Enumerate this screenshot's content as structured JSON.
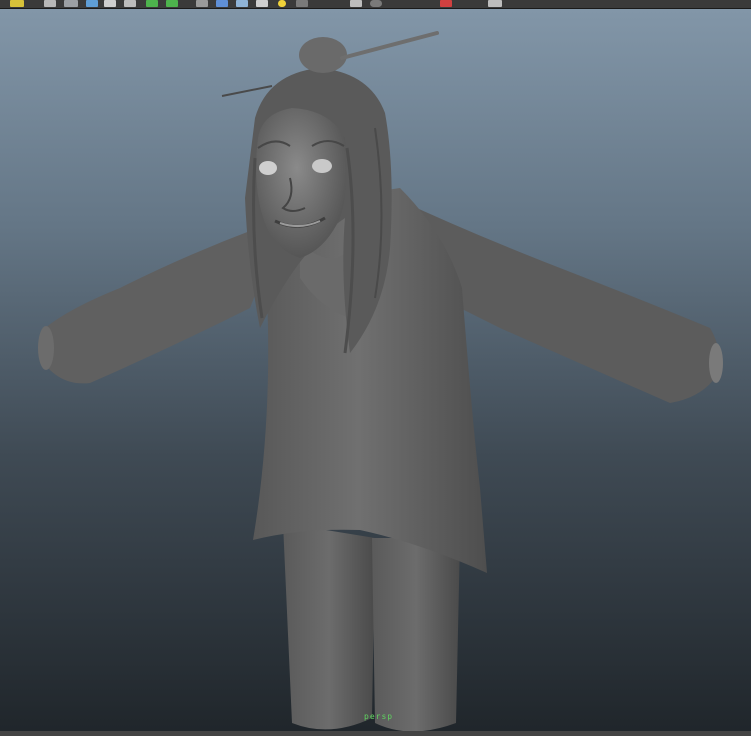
{
  "toolbar": {
    "icons": [
      "undo-icon",
      "render-icon",
      "grid-icon",
      "camera-icon",
      "film-gate-icon",
      "shaded-icon",
      "textured-icon",
      "lights-icon",
      "xray-icon",
      "isolate-icon",
      "wireframe-icon",
      "smooth-shade-icon",
      "default-light-icon",
      "shadow-icon",
      "ambient-occlusion-icon",
      "motion-blur-icon",
      "antialias-icon",
      "depth-icon"
    ]
  },
  "viewport": {
    "camera_label": "persp",
    "colors": {
      "gradient_top": "#8296a8",
      "gradient_bottom": "#20262b",
      "model": "#6a6a6a",
      "label": "#5fd35f"
    }
  }
}
